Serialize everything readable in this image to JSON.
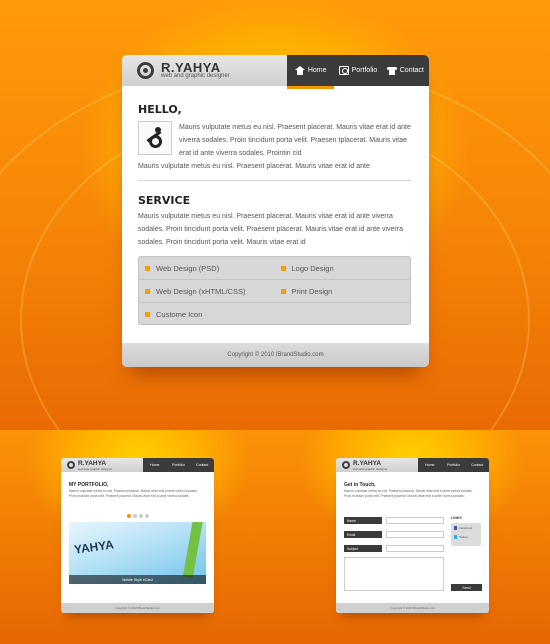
{
  "brand": {
    "name": "R.YAHYA",
    "tagline": "web and graphic designer"
  },
  "nav": [
    {
      "label": "Home",
      "icon": "home-icon"
    },
    {
      "label": "Portfolio",
      "icon": "portfolio-icon"
    },
    {
      "label": "Contact",
      "icon": "phone-icon"
    }
  ],
  "hello": {
    "title": "HELLO,",
    "text": "Mauris vulputate metus eu nisl. Praesent placerat. Mauris vitae erat id ante viverra sodales. Proin tincidunt porta velit. Praesen tplacerat. Mauris vitae erat id ante viverra sodales. Prointin cid",
    "tail": "Mauris vulputate metus eu nisl. Praesent placerat. Mauris vitae erat id ante"
  },
  "service": {
    "title": "SERVICE",
    "text": "Mauris vulputate metus eu nisl. Praesent placerat. Mauris vitae erat id ante viverra sodales. Proin tincidunt porta velit. Praesent placerat. Mauris vitae erat id ante viverra sodales. Proin tincidunt porta velit. Mauris vitae erat id",
    "items": [
      "Web Design (PSD)",
      "Logo Design",
      "Web Design (xHTML/CSS)",
      "Print Design",
      "Custome Icon"
    ]
  },
  "footer": {
    "copyright": "Copyright © 2010 IBrandStudio.com"
  },
  "mini_portfolio": {
    "title": "MY PORTFOLIO,",
    "text": "Mauris vulputate metus eu nisl. Praesent placerat. Mauris vitae erat id ante viverra sodales. Proin tincidunt porta velit. Praesent placerat. Mauris vitae erat id ante viverra sodales.",
    "slide_brand": "YAHYA",
    "caption": "Mobile Style eCard"
  },
  "mini_contact": {
    "title": "Get in Touch,",
    "text": "Mauris vulputate metus eu nisl. Praesent placerat. Mauris vitae erat id ante viverra sodales. Proin tincidunt porta velit. Praesent placerat. Mauris vitae erat id ante viverra sodales.",
    "fields": [
      "Name",
      "Email",
      "Subject"
    ],
    "send": "Send",
    "links_title": "LINKS",
    "links": [
      "Facebook",
      "Twitter"
    ]
  },
  "colors": {
    "accent": "#f39800",
    "dark": "#3b3b3b",
    "background": "#f07a06"
  }
}
